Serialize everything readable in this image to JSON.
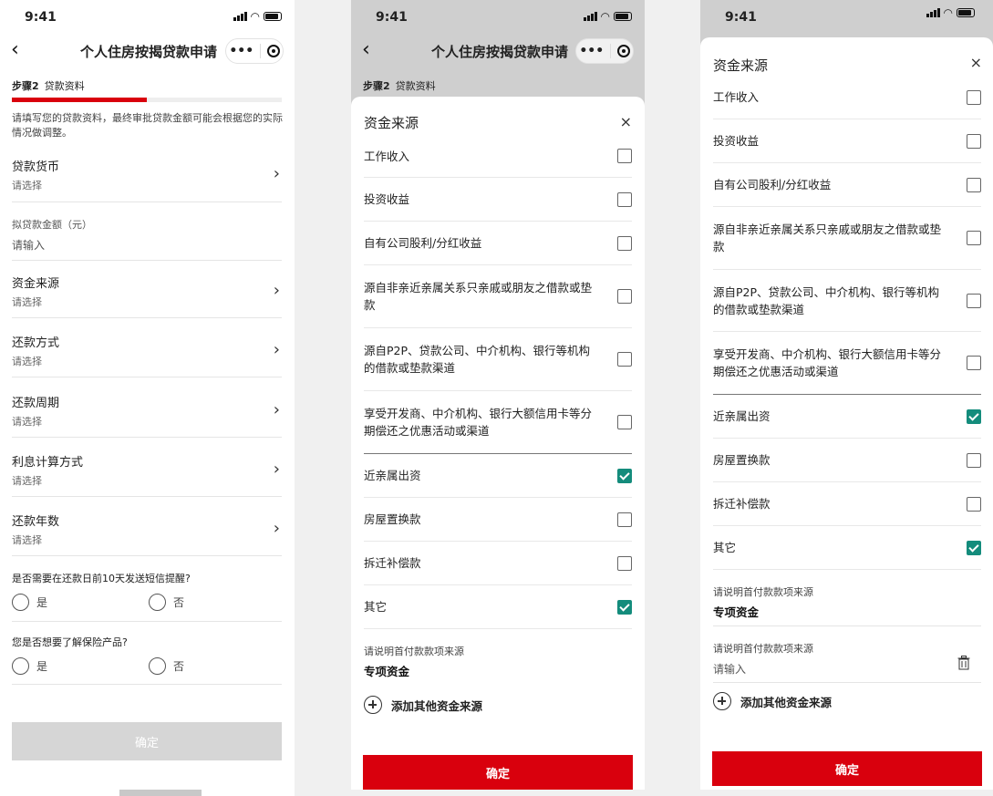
{
  "status": {
    "time": "9:41"
  },
  "nav": {
    "title": "个人住房按揭贷款申请",
    "more": "•••"
  },
  "form": {
    "step_label": "步骤2",
    "step_name": "贷款资料",
    "progress": 0.5,
    "hint": "请填写您的贷款资料，最终审批贷款金额可能会根据您的实际情况做调整。",
    "fields": [
      {
        "label": "贷款货币",
        "value": "请选择"
      },
      {
        "label": "拟贷款金额（元）",
        "value": "请输入"
      },
      {
        "label": "资金来源",
        "value": "请选择"
      },
      {
        "label": "还款方式",
        "value": "请选择"
      },
      {
        "label": "还款周期",
        "value": "请选择"
      },
      {
        "label": "利息计算方式",
        "value": "请选择"
      },
      {
        "label": "还款年数",
        "value": "请选择"
      }
    ],
    "q1": {
      "text": "是否需要在还款日前10天发送短信提醒?",
      "yes": "是",
      "no": "否"
    },
    "q2": {
      "text": "您是否想要了解保险产品?",
      "yes": "是",
      "no": "否"
    },
    "submit": "确定"
  },
  "sheet": {
    "title": "资金来源",
    "close": "×",
    "options": [
      {
        "text": "工作收入",
        "checked": false
      },
      {
        "text": "投资收益",
        "checked": false
      },
      {
        "text": "自有公司股利/分红收益",
        "checked": false
      },
      {
        "text": "源自非亲近亲属关系只亲戚或朋友之借款或垫款",
        "checked": false
      },
      {
        "text": "源自P2P、贷款公司、中介机构、银行等机构的借款或垫款渠道",
        "checked": false
      },
      {
        "text": "享受开发商、中介机构、银行大额信用卡等分期偿还之优惠活动或渠道",
        "checked": false
      },
      {
        "text": "近亲属出资",
        "checked": true
      },
      {
        "text": "房屋置换款",
        "checked": false
      },
      {
        "text": "拆迁补偿款",
        "checked": false
      },
      {
        "text": "其它",
        "checked": true
      }
    ],
    "explain_label": "请说明首付款款项来源",
    "explain_value": "专项资金",
    "explain_placeholder": "请输入",
    "add_label": "添加其他资金来源",
    "confirm": "确定"
  },
  "colors": {
    "accent": "#d9000d",
    "check": "#148c7c"
  }
}
